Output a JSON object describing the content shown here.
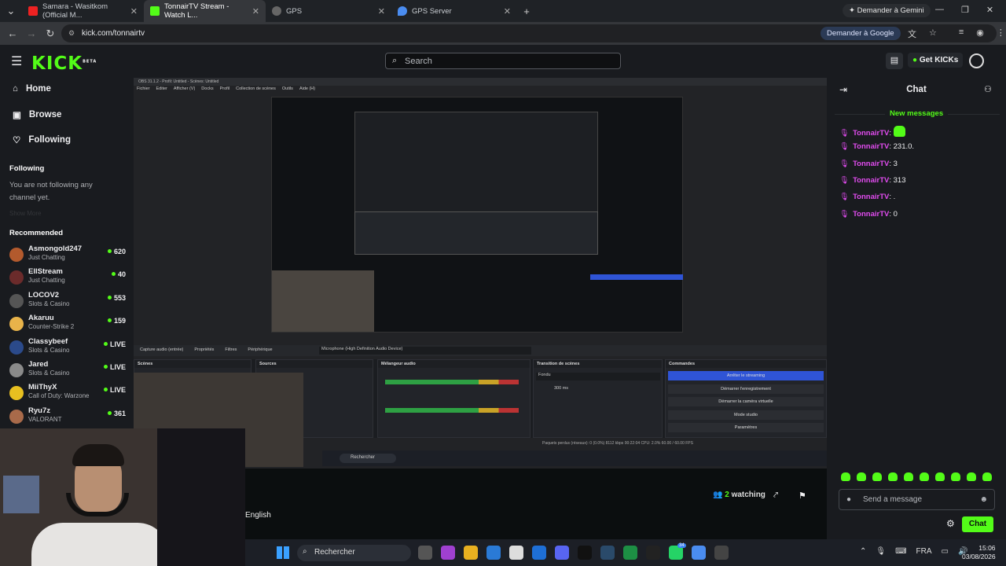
{
  "browser": {
    "tabs": [
      {
        "title": "Samara - Wasitkom (Official M...",
        "favicon_color": "#e22"
      },
      {
        "title": "TonnairTV Stream - Watch L...",
        "favicon_color": "#53fc18"
      },
      {
        "title": "GPS",
        "favicon_color": "#888"
      },
      {
        "title": "GPS Server",
        "favicon_color": "#4a8cf0"
      }
    ],
    "gemini_button": "Demander à Gemini",
    "url": "kick.com/tonnairtv",
    "google_pill": "Demander à Google"
  },
  "site": {
    "logo": "KICK",
    "logo_sup": "BETA",
    "search_placeholder": "Search",
    "get_kicks": "Get KICKs",
    "accent": "#53fc18"
  },
  "sidebar": {
    "nav": [
      {
        "label": "Home",
        "icon": "home-icon"
      },
      {
        "label": "Browse",
        "icon": "browse-icon"
      },
      {
        "label": "Following",
        "icon": "heart-icon"
      }
    ],
    "following_title": "Following",
    "following_empty": "You are not following any channel yet.",
    "show_more": "Show More",
    "recommended_title": "Recommended",
    "recommended": [
      {
        "name": "Asmongold247",
        "category": "Just Chatting",
        "viewers": "620",
        "color": "#b35a2d"
      },
      {
        "name": "EllStream",
        "category": "Just Chatting",
        "viewers": "40",
        "color": "#6b2b2b"
      },
      {
        "name": "LOCOV2",
        "category": "Slots & Casino",
        "viewers": "553",
        "color": "#555"
      },
      {
        "name": "Akaruu",
        "category": "Counter-Strike 2",
        "viewers": "159",
        "color": "#e8b34a"
      },
      {
        "name": "Classybeef",
        "category": "Slots & Casino",
        "viewers": "LIVE",
        "color": "#2b4a8a"
      },
      {
        "name": "Jared",
        "category": "Slots & Casino",
        "viewers": "LIVE",
        "color": "#8a8a8a"
      },
      {
        "name": "MiiThyX",
        "category": "Call of Duty: Warzone",
        "viewers": "LIVE",
        "color": "#e8c020"
      },
      {
        "name": "Ryu7z",
        "category": "VALORANT",
        "viewers": "361",
        "color": "#a86a4a"
      }
    ]
  },
  "stream": {
    "obs_title": "OBS 31.1.2 - Profil: Untitled - Scènes: Untitled",
    "obs_menu": [
      "Fichier",
      "Editer",
      "Afficher (V)",
      "Docks",
      "Profil",
      "Collection de scènes",
      "Outils",
      "Aide (H)"
    ],
    "obs_panels": [
      "Scènes",
      "Sources",
      "Mélangeur audio",
      "Transition de scènes",
      "Commandes"
    ],
    "obs_buttons": [
      "Arrêter le streaming",
      "Démarrer l'enregistrement",
      "Démarrer la caméra virtuelle",
      "Mode studio",
      "Paramètres"
    ],
    "obs_source_tabs": [
      "Capture audio (entrée)",
      "Propriétés",
      "Filtres",
      "Périphérique"
    ],
    "obs_device": "Microphone (High Definition Audio Device)",
    "obs_transition": "Fondu",
    "obs_duration": "300 ms",
    "obs_status": "Paquets perdus (réseaux): 0 (0.0%)   8112 kbps   00:22:04   CPU: 2.0%   60.00 / 60.00 FPS",
    "inner_taskbar_search": "Rechercher",
    "watching_count": "2",
    "watching_label": "watching",
    "language": "English"
  },
  "chat": {
    "title": "Chat",
    "new_messages": "New messages",
    "messages": [
      {
        "user": "TonnairTV",
        "text": "",
        "emote": true
      },
      {
        "user": "TonnairTV",
        "text": "231.0.",
        "emote": false
      },
      {
        "user": "TonnairTV",
        "text": "3",
        "emote": false
      },
      {
        "user": "TonnairTV",
        "text": "313",
        "emote": false
      },
      {
        "user": "TonnairTV",
        "text": ".",
        "emote": false
      },
      {
        "user": "TonnairTV",
        "text": "0",
        "emote": false
      }
    ],
    "placeholder": "Send a message",
    "send_label": "Chat"
  },
  "taskbar": {
    "search": "Rechercher",
    "lang": "FRA",
    "time": "15:06",
    "date": "03/08/2026",
    "badge": "34"
  }
}
